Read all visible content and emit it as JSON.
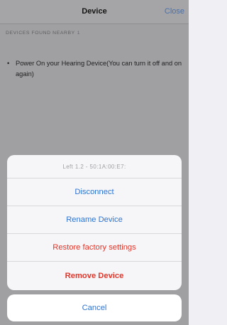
{
  "navbar": {
    "title": "Device",
    "close_label": "Close"
  },
  "section": {
    "header": "DEVICES FOUND NEARBY",
    "suffix": "1"
  },
  "hint": {
    "bullet": "•",
    "text": "Power On your Hearing Device(You can turn it off and on again)"
  },
  "action_sheet": {
    "header": "Left 1.2 - 50:1A:00:E7:",
    "items": [
      {
        "label": "Disconnect",
        "color": "#2f74d0"
      },
      {
        "label": "Rename Device",
        "color": "#2f74d0"
      },
      {
        "label": "Restore factory settings",
        "color": "#e53529"
      },
      {
        "label": "Remove Device",
        "color": "#e53529"
      }
    ],
    "cancel_label": "Cancel"
  }
}
